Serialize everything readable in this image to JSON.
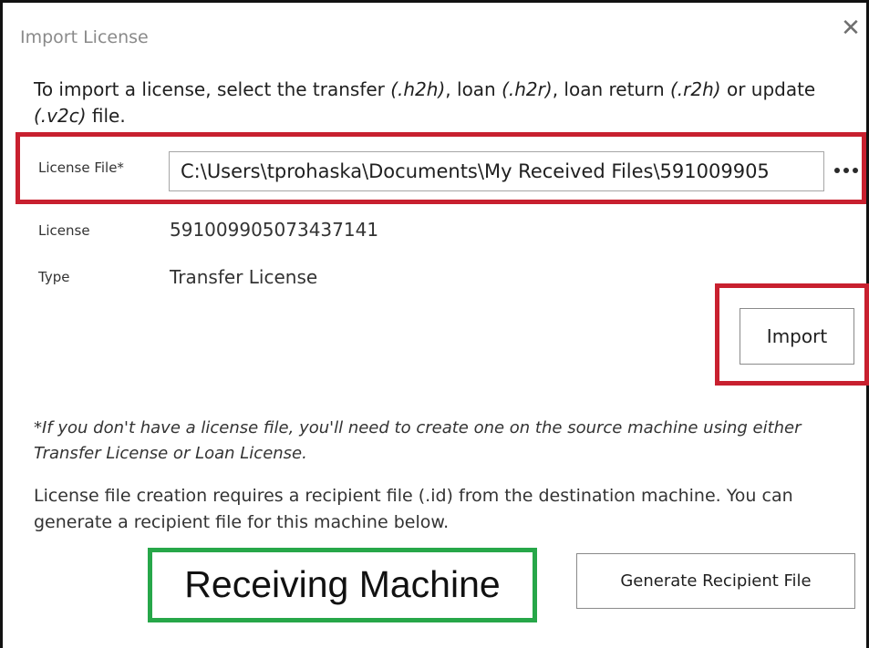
{
  "dialog": {
    "title": "Import License",
    "close_symbol": "✕",
    "close_icon": "close-icon"
  },
  "instruction": {
    "text_1": "To import a license, select the transfer ",
    "ext_transfer": "(.h2h)",
    "text_2": ", loan ",
    "ext_loan": "(.h2r)",
    "text_3": ", loan return ",
    "ext_loan_return": "(.r2h)",
    "text_4": " or update ",
    "ext_update": "(.v2c)",
    "text_5": " file."
  },
  "license_file": {
    "label": "License File*",
    "value": "C:\\Users\\tprohaska\\Documents\\My Received Files\\591009905",
    "browse_icon": "ellipsis-icon"
  },
  "license": {
    "label": "License",
    "value": "591009905073437141"
  },
  "type": {
    "label": "Type",
    "value": "Transfer License"
  },
  "buttons": {
    "import": "Import",
    "generate": "Generate Recipient File"
  },
  "note": "*If you don't have a license file, you'll need to create one on the source machine using either Transfer License or Loan License.",
  "description": "License file creation requires a recipient file (.id) from the destination machine. You can generate a recipient file for this machine below.",
  "annotation": {
    "text": "Receiving Machine"
  },
  "colors": {
    "highlight_red": "#c8202f",
    "highlight_green": "#27a749",
    "title_gray": "#8a8a8a"
  }
}
